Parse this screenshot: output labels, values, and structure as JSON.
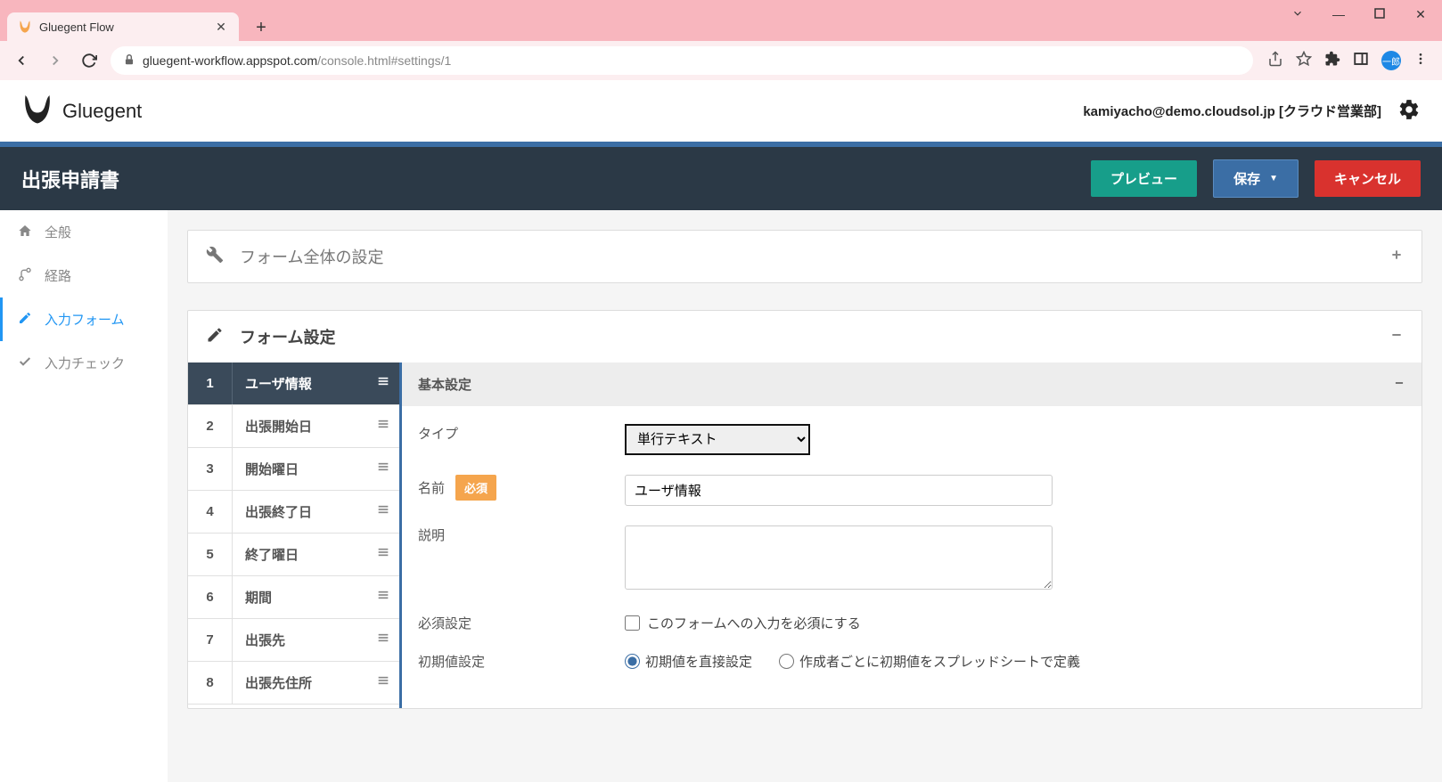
{
  "browser": {
    "tab_title": "Gluegent Flow",
    "url_host": "gluegent-workflow.appspot.com",
    "url_path": "/console.html#settings/1"
  },
  "app": {
    "brand": "Gluegent",
    "user": "kamiyacho@demo.cloudsol.jp [クラウド営業部]"
  },
  "docbar": {
    "title": "出張申請書",
    "preview": "プレビュー",
    "save": "保存",
    "cancel": "キャンセル"
  },
  "sidebar": {
    "items": [
      {
        "label": "全般",
        "icon": "home"
      },
      {
        "label": "経路",
        "icon": "route"
      },
      {
        "label": "入力フォーム",
        "icon": "pencil",
        "active": true
      },
      {
        "label": "入力チェック",
        "icon": "check"
      }
    ]
  },
  "panels": {
    "form_global": "フォーム全体の設定",
    "form_settings": "フォーム設定"
  },
  "fields": [
    {
      "n": "1",
      "name": "ユーザ情報",
      "selected": true
    },
    {
      "n": "2",
      "name": "出張開始日"
    },
    {
      "n": "3",
      "name": "開始曜日"
    },
    {
      "n": "4",
      "name": "出張終了日"
    },
    {
      "n": "5",
      "name": "終了曜日"
    },
    {
      "n": "6",
      "name": "期間"
    },
    {
      "n": "7",
      "name": "出張先"
    },
    {
      "n": "8",
      "name": "出張先住所"
    }
  ],
  "config": {
    "section_title": "基本設定",
    "type_label": "タイプ",
    "type_value": "単行テキスト",
    "name_label": "名前",
    "required_badge": "必須",
    "name_value": "ユーザ情報",
    "desc_label": "説明",
    "req_label": "必須設定",
    "req_checkbox": "このフォームへの入力を必須にする",
    "init_label": "初期値設定",
    "init_radio_direct": "初期値を直接設定",
    "init_radio_sheet": "作成者ごとに初期値をスプレッドシートで定義"
  }
}
